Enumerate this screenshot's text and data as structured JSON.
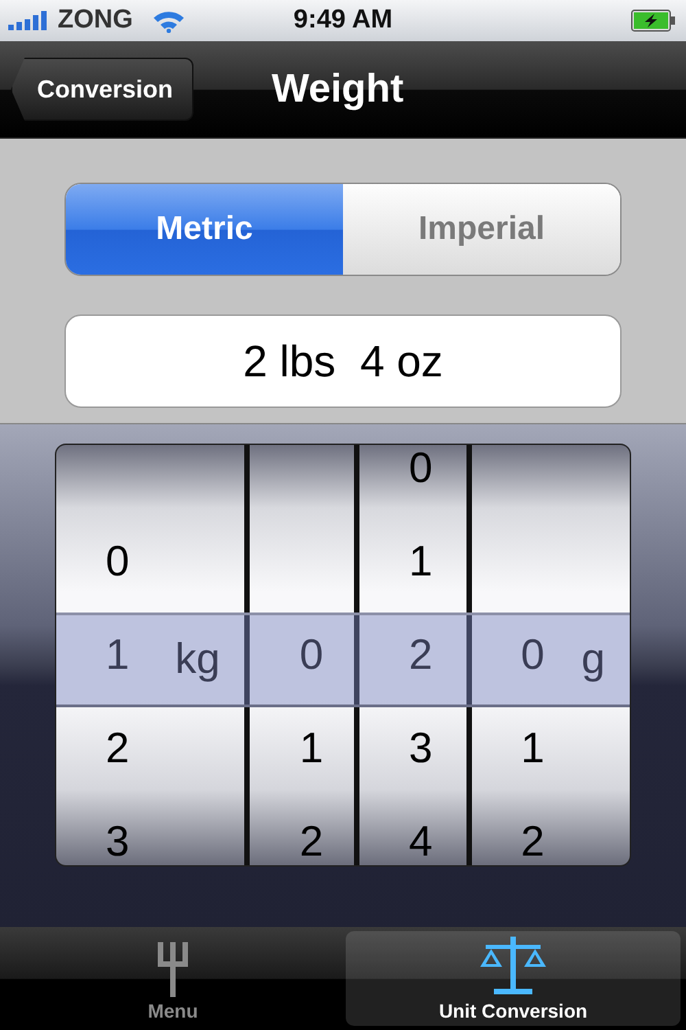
{
  "status_bar": {
    "carrier": "ZONG",
    "time": "9:49 AM"
  },
  "nav_bar": {
    "back": "Conversion",
    "title": "Weight"
  },
  "segments": [
    {
      "label": "Metric",
      "selected": true
    },
    {
      "label": "Imperial",
      "selected": false
    }
  ],
  "result": {
    "value": "2 lbs  4 oz"
  },
  "picker": {
    "columns": [
      {
        "unit": "kg",
        "items": [
          {
            "label": "0",
            "selected": false
          },
          {
            "label": "1",
            "selected": true
          },
          {
            "label": "2",
            "selected": false
          },
          {
            "label": "3",
            "selected": false
          }
        ]
      },
      {
        "items": [
          {
            "label": "0",
            "selected": true
          },
          {
            "label": "1",
            "selected": false
          },
          {
            "label": "2",
            "selected": false
          }
        ]
      },
      {
        "items": [
          {
            "label": "0",
            "selected": false
          },
          {
            "label": "1",
            "selected": false
          },
          {
            "label": "2",
            "selected": true
          },
          {
            "label": "3",
            "selected": false
          },
          {
            "label": "4",
            "selected": false
          }
        ]
      },
      {
        "unit": "g",
        "items": [
          {
            "label": "0",
            "selected": true
          },
          {
            "label": "1",
            "selected": false
          },
          {
            "label": "2",
            "selected": false
          }
        ]
      }
    ]
  },
  "tab_bar": [
    {
      "label": "Menu",
      "kind": "trident",
      "selected": false
    },
    {
      "label": "Unit Conversion",
      "kind": "scale",
      "selected": true
    }
  ]
}
